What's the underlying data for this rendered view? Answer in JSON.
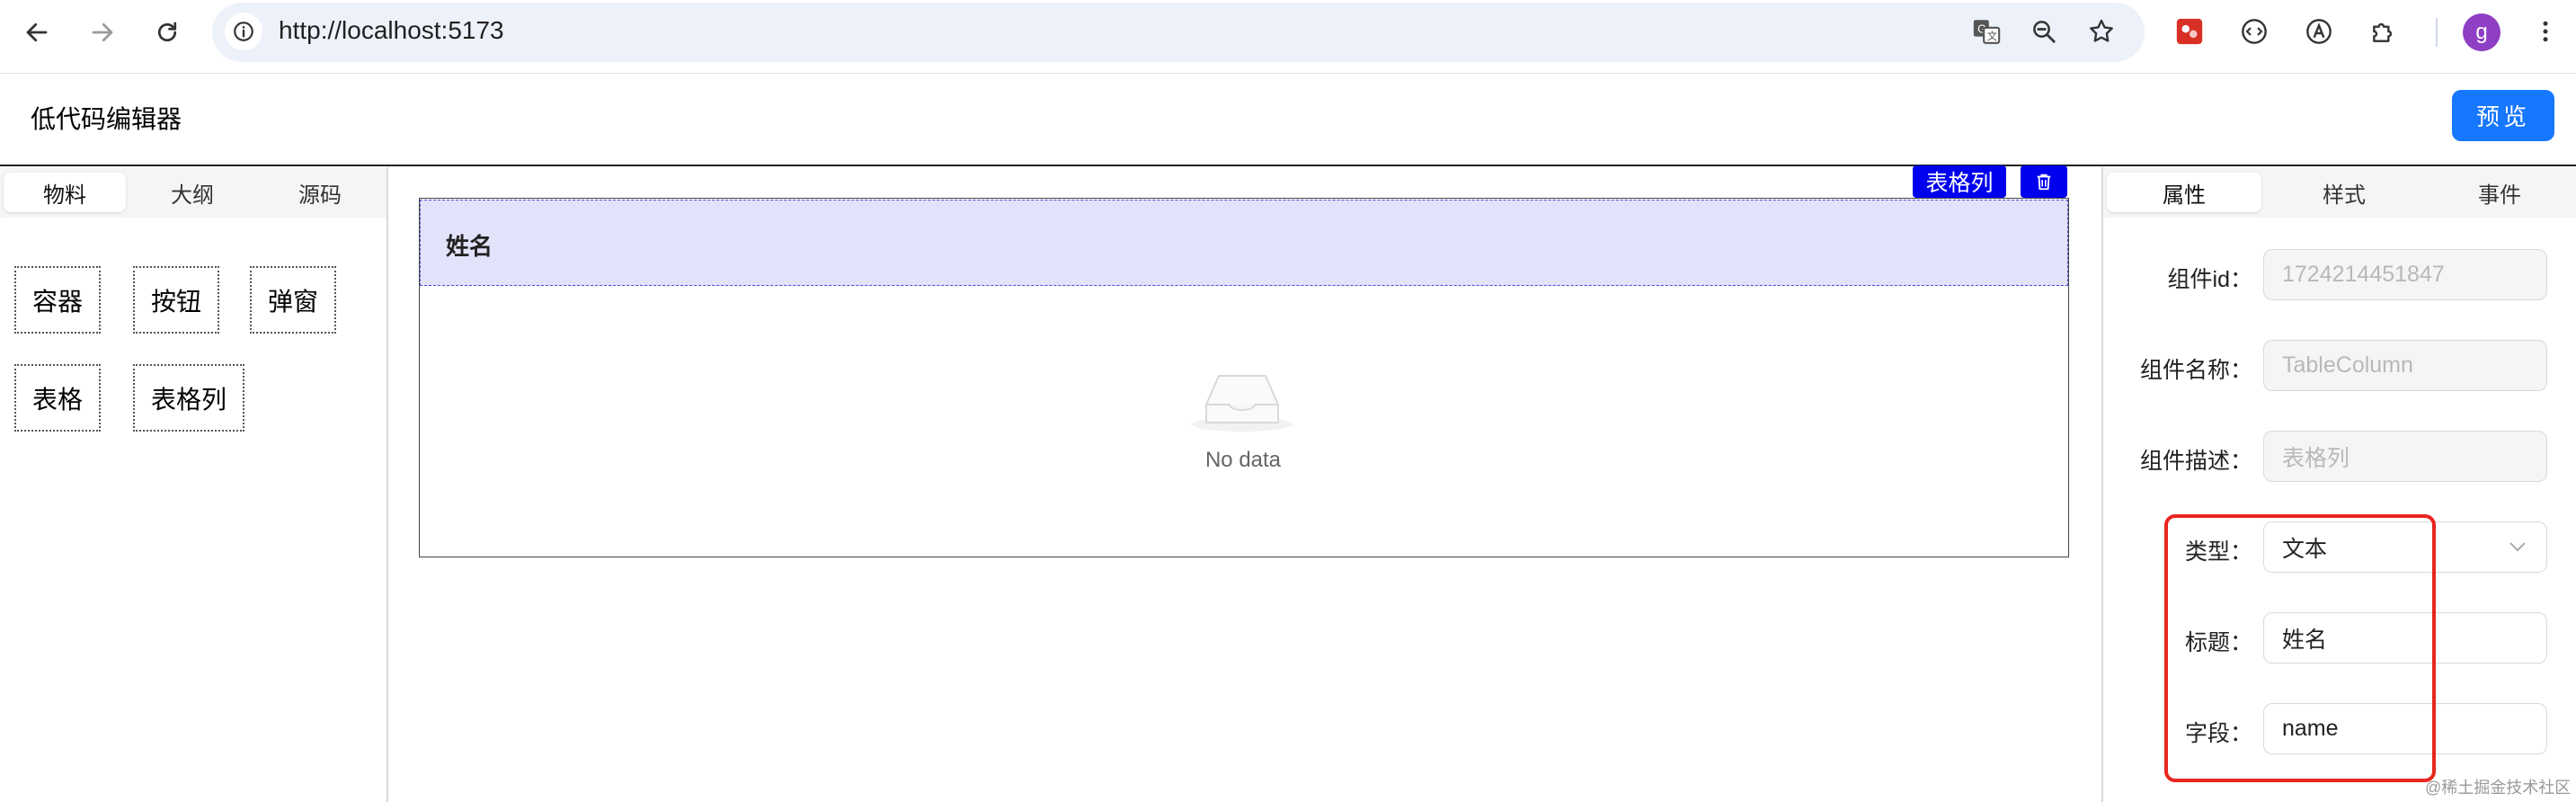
{
  "browser": {
    "url": "http://localhost:5173",
    "avatar_letter": "g",
    "icons": [
      "back-arrow-icon",
      "forward-arrow-icon",
      "reload-icon",
      "site-info-icon",
      "translate-icon",
      "zoom-icon",
      "bookmark-star-icon",
      "extension-red-icon",
      "extension-code-icon",
      "extension-a-icon",
      "puzzle-icon",
      "menu-dots-icon"
    ]
  },
  "app": {
    "title": "低代码编辑器",
    "preview_button": "预览"
  },
  "left_panel": {
    "tabs": [
      "物料",
      "大纲",
      "源码"
    ],
    "active_tab": 0,
    "components": [
      "容器",
      "按钮",
      "弹窗",
      "表格",
      "表格列"
    ]
  },
  "canvas": {
    "selected_label": "表格列",
    "column_header": "姓名",
    "empty_text": "No data"
  },
  "right_panel": {
    "tabs": [
      "属性",
      "样式",
      "事件"
    ],
    "active_tab": 0,
    "fields": [
      {
        "label": "组件id：",
        "value": "1724214451847",
        "disabled": true
      },
      {
        "label": "组件名称：",
        "value": "TableColumn",
        "disabled": true
      },
      {
        "label": "组件描述：",
        "value": "表格列",
        "disabled": true
      },
      {
        "label": "类型：",
        "value": "文本",
        "type": "select"
      },
      {
        "label": "标题：",
        "value": "姓名"
      },
      {
        "label": "字段：",
        "value": "name"
      }
    ]
  },
  "watermark": "@稀土掘金技术社区",
  "colors": {
    "primary": "#1677ff",
    "selection": "#0000ee",
    "highlight": "#e8261f",
    "header_bg": "#e2e2fa"
  }
}
